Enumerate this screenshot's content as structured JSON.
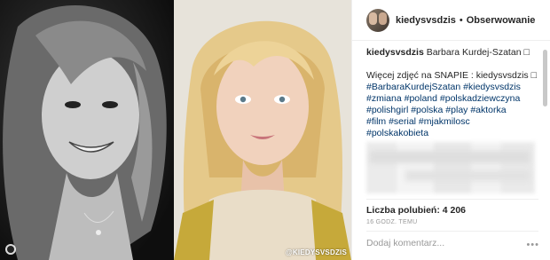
{
  "media": {
    "watermark": "@KIEDYSVSDZIS",
    "icons": [
      "person-tag-icon"
    ]
  },
  "header": {
    "username": "kiedysvsdzis",
    "separator": "•",
    "follow_label": "Obserwowanie"
  },
  "caption": {
    "username": "kiedysvsdzis",
    "title": "Barbara Kurdej-Szatan □",
    "line2": "Więcej zdjęć na SNAPIE : kiedysvsdzis □",
    "hashtag_lines": [
      "#BarbaraKurdejSzatan #kiedysvsdzis",
      "#zmiana #poland #polskadziewczyna",
      "#polishgirl #polska #play #aktorka",
      "#film #serial #mjakmilosc",
      "#polskakobieta"
    ]
  },
  "stats": {
    "likes": "Liczba polubień: 4 206",
    "time": "16 GODZ. TEMU"
  },
  "comment": {
    "placeholder": "Dodaj komentarz...",
    "more": "•••"
  },
  "colors": {
    "hashtag": "#003569",
    "text": "#262626",
    "muted": "#999999",
    "border": "#efefef"
  }
}
